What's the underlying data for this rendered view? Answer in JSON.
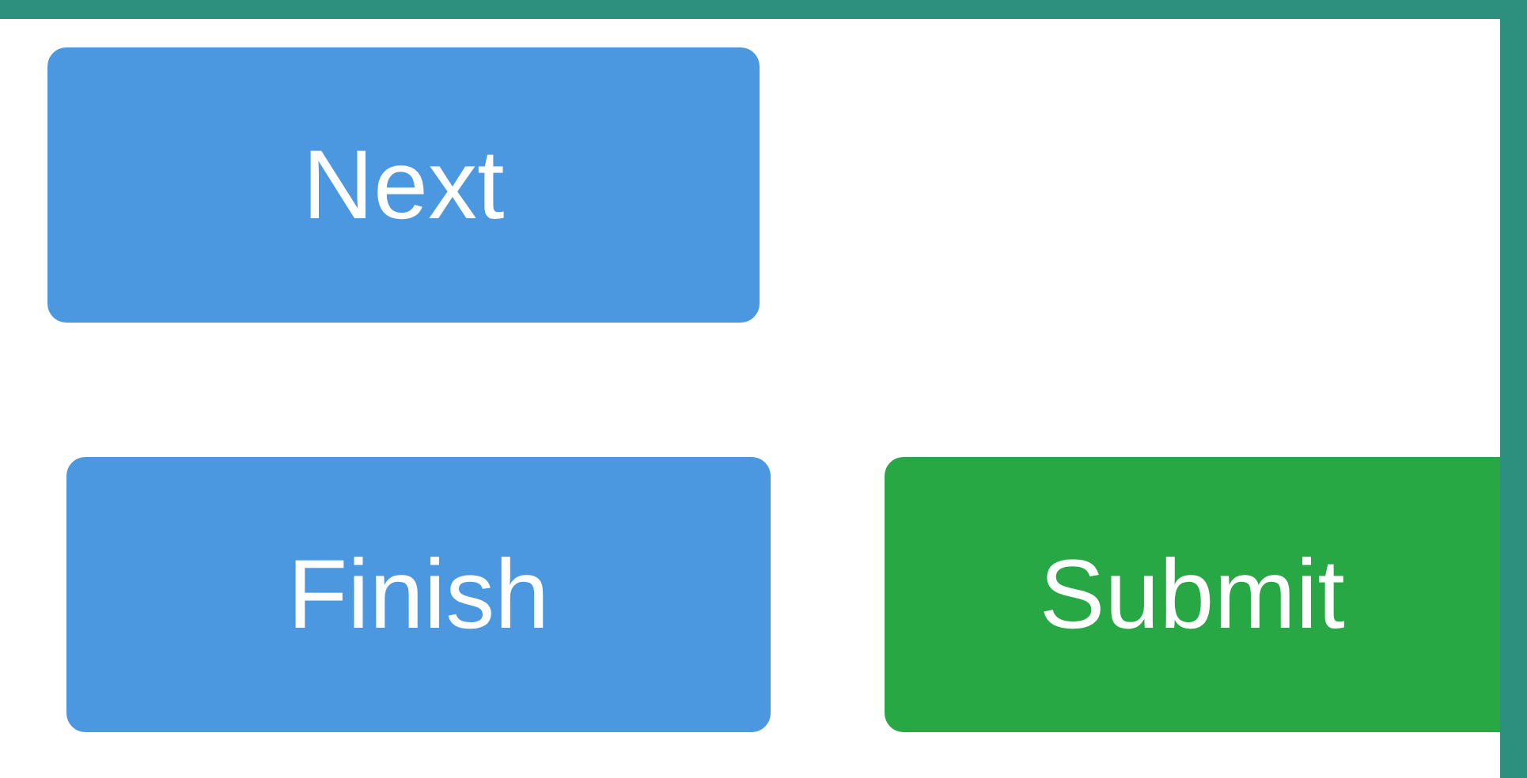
{
  "button_rows": [
    {
      "buttons": [
        {
          "label": "Next",
          "kind": "primary"
        }
      ]
    },
    {
      "buttons": [
        {
          "label": "Finish",
          "kind": "primary"
        },
        {
          "label": "Submit",
          "kind": "success"
        }
      ]
    }
  ]
}
